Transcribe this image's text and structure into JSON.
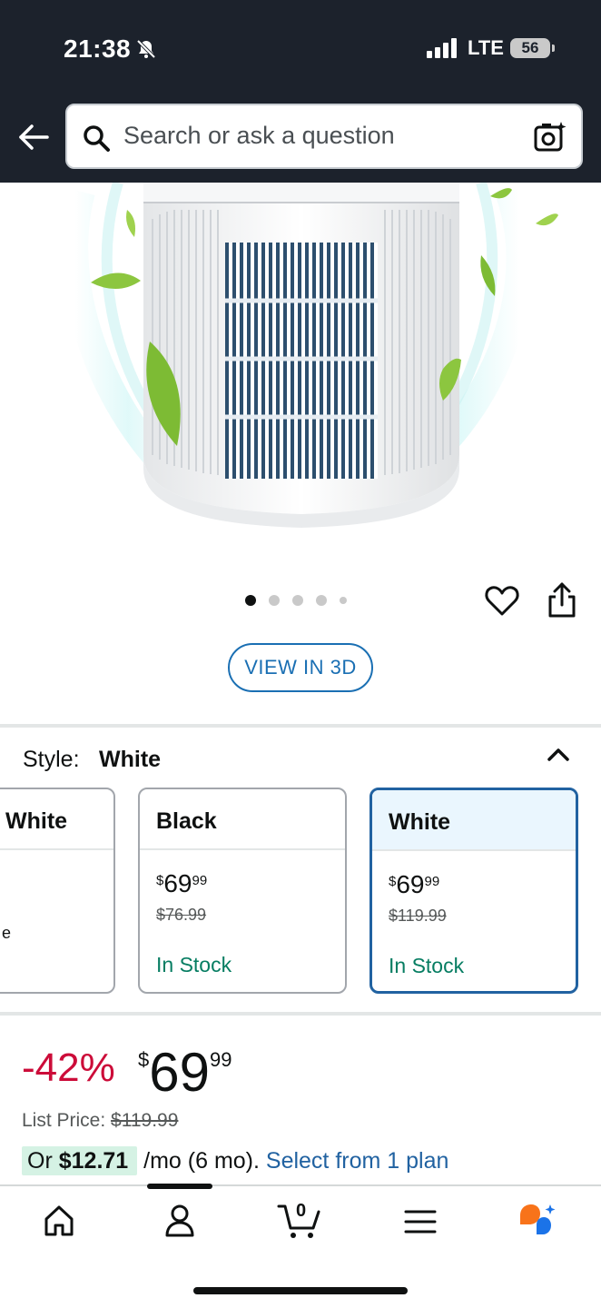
{
  "status_bar": {
    "time": "21:38",
    "network": "LTE",
    "battery": "56"
  },
  "search": {
    "placeholder": "Search or ask a question"
  },
  "carousel": {
    "total_images": 5,
    "active_index": 0
  },
  "view_3d_label": "VIEW IN 3D",
  "style": {
    "label": "Style:",
    "value": "White",
    "options": [
      {
        "name": "White",
        "edge_text": "e"
      },
      {
        "name": "Black",
        "price_whole": "69",
        "price_fraction": "99",
        "currency": "$",
        "list_price": "$76.99",
        "stock": "In Stock"
      },
      {
        "name": "White",
        "price_whole": "69",
        "price_fraction": "99",
        "currency": "$",
        "list_price": "$119.99",
        "stock": "In Stock",
        "selected": true
      }
    ]
  },
  "price": {
    "discount": "-42%",
    "currency": "$",
    "whole": "69",
    "fraction": "99",
    "list_label": "List Price:",
    "list_value": "$119.99",
    "plan_prefix": "Or",
    "plan_amount": "$12.71",
    "plan_suffix": " /mo (6 mo). ",
    "plan_link": "Select from 1 plan"
  },
  "bottom_nav": {
    "items": [
      "home-icon",
      "account-icon",
      "cart-icon",
      "menu-icon",
      "rufus-icon"
    ],
    "cart_count": "0",
    "active_index": 1
  },
  "colors": {
    "header_bg": "#1c222c",
    "link": "#2162a1",
    "deal_red": "#cc0c39",
    "in_stock_green": "#067d62",
    "selected_border": "#2162a1"
  }
}
